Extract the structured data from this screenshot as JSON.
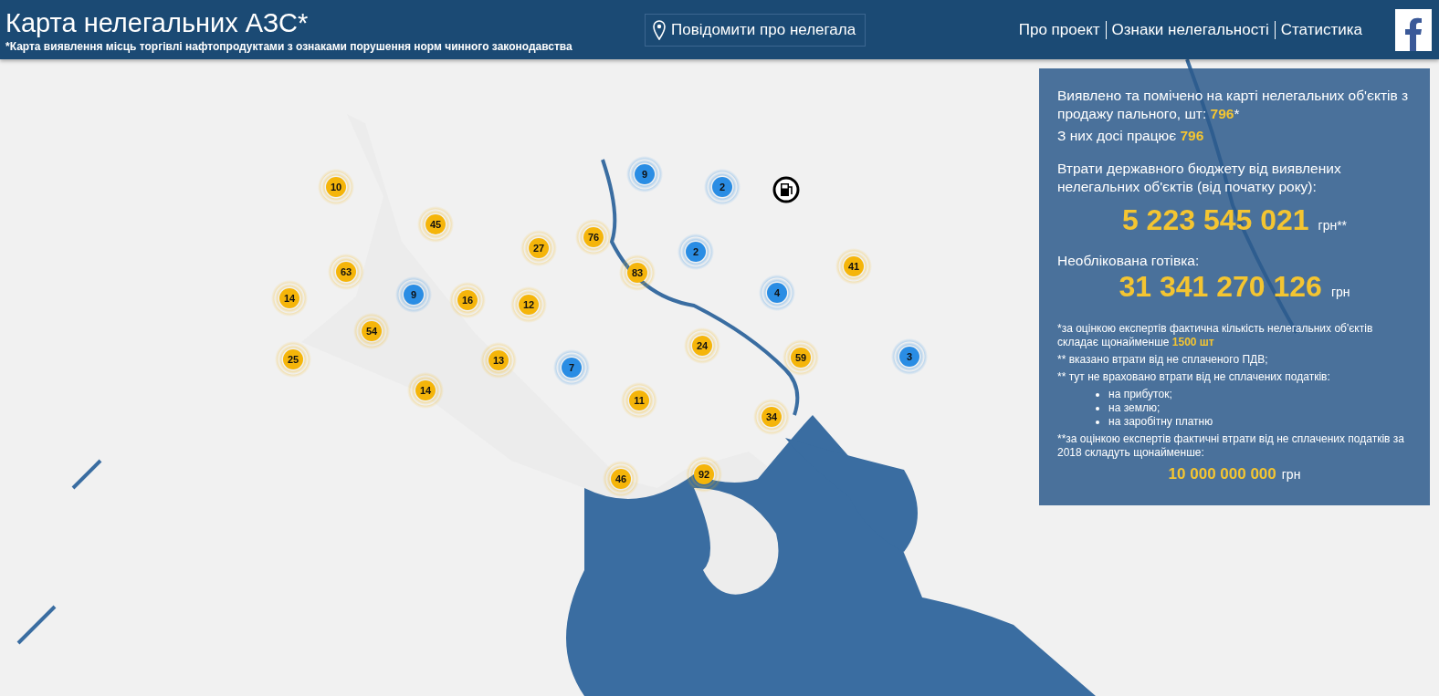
{
  "header": {
    "title": "Карта нелегальних АЗС*",
    "subtitle": "*Карта виявлення місць торгівлі нафтопродуктами з ознаками порушення норм чинного законодавства",
    "report_button": "Повідомити про нелегала",
    "nav": [
      "Про проект",
      "Ознаки нелегальності",
      "Статистика"
    ]
  },
  "map": {
    "markers": [
      {
        "count": "10",
        "color": "#f5b50a"
      },
      {
        "count": "45",
        "color": "#f5b50a"
      },
      {
        "count": "27",
        "color": "#f5b50a"
      },
      {
        "count": "76",
        "color": "#f5b50a"
      },
      {
        "count": "9",
        "color": "#2a8de4"
      },
      {
        "count": "2",
        "color": "#2a8de4"
      },
      {
        "count": "2",
        "color": "#2a8de4"
      },
      {
        "count": "83",
        "color": "#f5b50a"
      },
      {
        "count": "63",
        "color": "#f5b50a"
      },
      {
        "count": "14",
        "color": "#f5b50a"
      },
      {
        "count": "9",
        "color": "#2a8de4"
      },
      {
        "count": "16",
        "color": "#f5b50a"
      },
      {
        "count": "12",
        "color": "#f5b50a"
      },
      {
        "count": "54",
        "color": "#f5b50a"
      },
      {
        "count": "25",
        "color": "#f5b50a"
      },
      {
        "count": "13",
        "color": "#f5b50a"
      },
      {
        "count": "7",
        "color": "#2a8de4"
      },
      {
        "count": "24",
        "color": "#f5b50a"
      },
      {
        "count": "59",
        "color": "#f5b50a"
      },
      {
        "count": "4",
        "color": "#2a8de4"
      },
      {
        "count": "41",
        "color": "#f5b50a"
      },
      {
        "count": "3",
        "color": "#2a8de4"
      },
      {
        "count": "14",
        "color": "#f5b50a"
      },
      {
        "count": "11",
        "color": "#f5b50a"
      },
      {
        "count": "34",
        "color": "#f5b50a"
      },
      {
        "count": "92",
        "color": "#f5b50a"
      },
      {
        "count": "46",
        "color": "#f5b50a"
      }
    ]
  },
  "stats": {
    "detected": {
      "text": "Виявлено та помічено на карті нелегальних об'єктів з продажу пального, шт:",
      "value": "796",
      "suffix": "*"
    },
    "working": {
      "text": "З них досі працює",
      "value": "796"
    },
    "losses_label": "Втрати державного бюджету від виявлених нелегальних об'єктів (від початку року):",
    "losses_value": "5 223 545 021",
    "losses_unit": "грн**",
    "cash_label": "Необлікована готівка:",
    "cash_value": "31 341 270 126",
    "cash_unit": "грн",
    "notes": [
      "*за оцінкою експертів фактична кількість нелегальних об'єктів складає щонайменше **1500 шт**",
      "** вказано втрати від не сплаченого ПДВ;",
      "** тут не враховано втрати від не сплачених податків:"
    ],
    "note_items": [
      "на прибуток;",
      "на землю;",
      "на заробітну платню"
    ],
    "final_note": "**за оцінкою експертів фактичні втрати від не сплачених податків за 2018 складуть щонайменше:",
    "final_value": "10 000 000 000",
    "final_unit": "грн"
  }
}
